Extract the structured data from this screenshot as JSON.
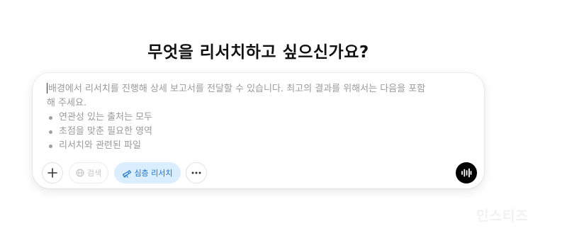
{
  "heading": "무엇을 리서치하고 싶으신가요?",
  "composer": {
    "placeholder_line1": "배경에서 리서치를 진행해 상세 보고서를 전달할 수 있습니다. 최고의 결과를 위해서는 다음을 포함",
    "placeholder_line2": "해 주세요.",
    "bullets": [
      "연관성 있는 출처는 모두",
      "초점을 맞춘 필요한 영역",
      "리서치와 관련된 파일"
    ]
  },
  "toolbar": {
    "plus_icon": "plus-icon",
    "search_icon": "globe-icon",
    "search_label": "검색",
    "deep_research_icon": "telescope-icon",
    "deep_research_label": "심층 리서치",
    "more_icon": "ellipsis-icon",
    "voice_icon": "voice-waveform-icon"
  },
  "colors": {
    "accent": "#1a73c9",
    "accent_bg": "#dbeeff",
    "voice_bg": "#000000",
    "placeholder": "#9a9a9a"
  },
  "watermark": "인스티즈"
}
